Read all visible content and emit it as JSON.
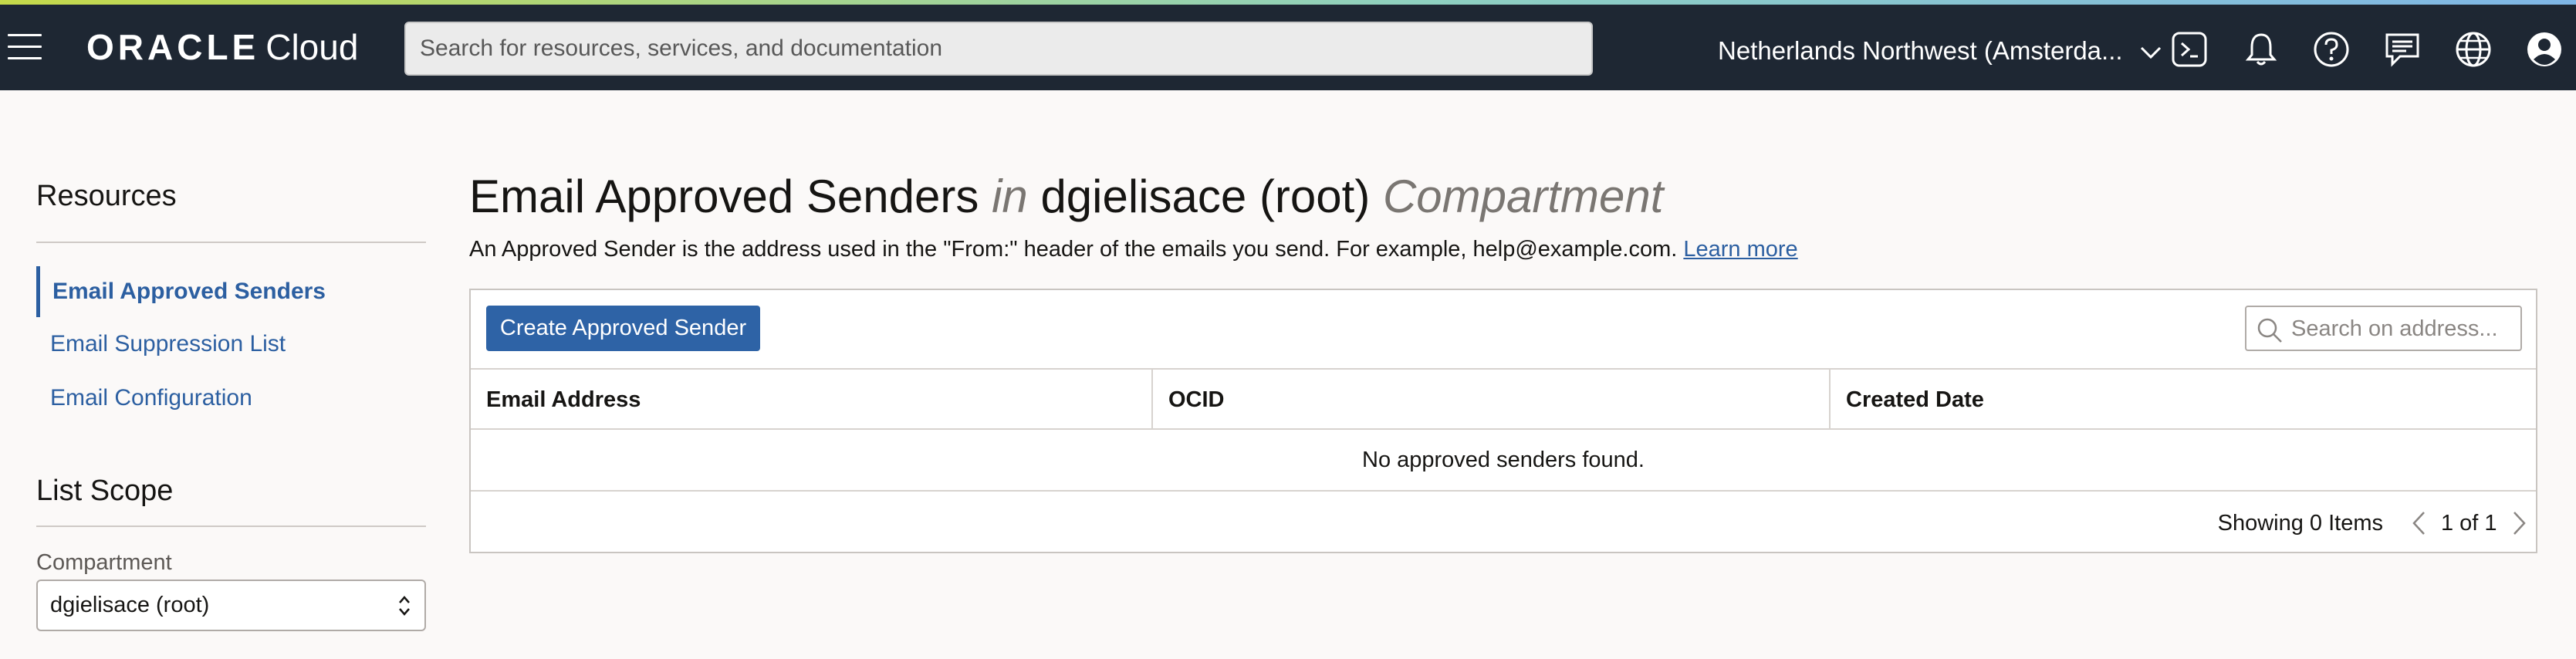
{
  "topbar": {
    "logo_brand": "ORACLE",
    "logo_product": "Cloud",
    "search_placeholder": "Search for resources, services, and documentation",
    "region": "Netherlands Northwest (Amsterda...",
    "icons": [
      "menu-icon",
      "cloud-shell-icon",
      "bell-icon",
      "help-icon",
      "chat-icon",
      "globe-icon",
      "user-icon"
    ]
  },
  "sidebar": {
    "resources_heading": "Resources",
    "items": [
      {
        "label": "Email Approved Senders",
        "active": true
      },
      {
        "label": "Email Suppression List",
        "active": false
      },
      {
        "label": "Email Configuration",
        "active": false
      }
    ],
    "scope_heading": "List Scope",
    "compartment_label": "Compartment",
    "compartment_value": "dgielisace (root)"
  },
  "main": {
    "title_part1": "Email Approved Senders",
    "title_in": "in",
    "title_part2": "dgielisace (root)",
    "title_part3": "Compartment",
    "description": "An Approved Sender is the address used in the \"From:\" header of the emails you send. For example, help@example.com.",
    "learn_more": "Learn more",
    "create_button": "Create Approved Sender",
    "table_search_placeholder": "Search on address...",
    "columns": [
      "Email Address",
      "OCID",
      "Created Date"
    ],
    "empty_message": "No approved senders found.",
    "showing": "Showing 0 Items",
    "page_indicator": "1 of 1"
  },
  "colors": {
    "topbar_bg": "#1e2733",
    "link": "#2c5fa1",
    "primary_button": "#2e63a6",
    "page_bg": "#fbf9f8"
  }
}
